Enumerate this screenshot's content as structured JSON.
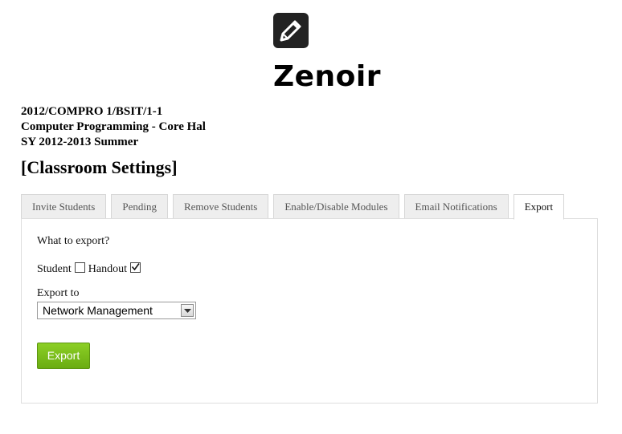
{
  "brand": {
    "name": "Zenoir",
    "logo_icon": "edit-pencil-icon"
  },
  "course": {
    "code": "2012/COMPRO 1/BSIT/1-1",
    "name": "Computer Programming - Core Hal",
    "term": "SY 2012-2013 Summer"
  },
  "page": {
    "title": "[Classroom Settings]"
  },
  "tabs": [
    {
      "label": "Invite Students",
      "active": false
    },
    {
      "label": "Pending",
      "active": false
    },
    {
      "label": "Remove Students",
      "active": false
    },
    {
      "label": "Enable/Disable Modules",
      "active": false
    },
    {
      "label": "Email Notifications",
      "active": false
    },
    {
      "label": "Export",
      "active": true
    }
  ],
  "export_form": {
    "question": "What to export?",
    "options": [
      {
        "label": "Student",
        "checked": false
      },
      {
        "label": "Handout",
        "checked": true
      }
    ],
    "export_to_label": "Export to",
    "export_to_value": "Network Management",
    "submit_label": "Export"
  },
  "colors": {
    "button_green": "#76b81a",
    "tab_inactive_bg": "#eeeeee"
  }
}
